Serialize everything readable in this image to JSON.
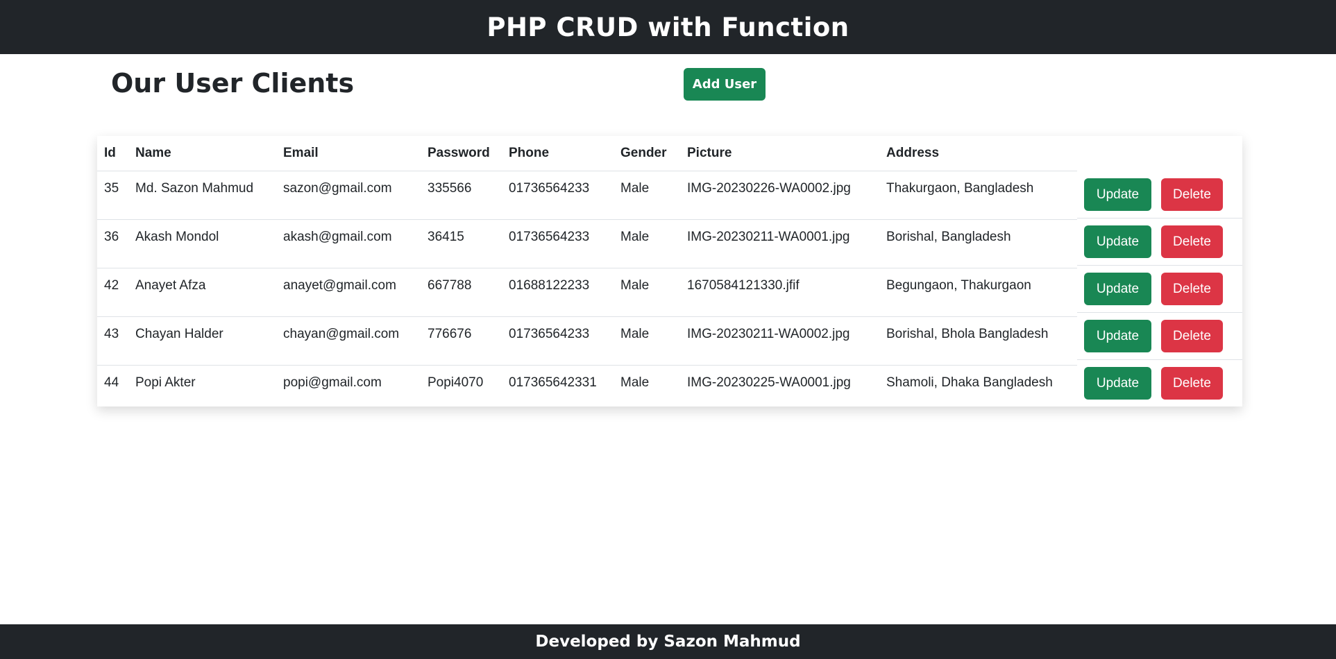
{
  "header": {
    "title": "PHP CRUD with Function"
  },
  "main": {
    "heading": "Our User Clients",
    "add_button_label": "Add User"
  },
  "table": {
    "columns": [
      "Id",
      "Name",
      "Email",
      "Password",
      "Phone",
      "Gender",
      "Picture",
      "Address"
    ],
    "rows": [
      [
        "35",
        "Md. Sazon Mahmud",
        "sazon@gmail.com",
        "335566",
        "01736564233",
        "Male",
        "IMG-20230226-WA0002.jpg",
        "Thakurgaon, Bangladesh"
      ],
      [
        "36",
        "Akash Mondol",
        "akash@gmail.com",
        "36415",
        "01736564233",
        "Male",
        "IMG-20230211-WA0001.jpg",
        "Borishal, Bangladesh"
      ],
      [
        "42",
        "Anayet Afza",
        "anayet@gmail.com",
        "667788",
        "01688122233",
        "Male",
        "1670584121330.jfif",
        "Begungaon, Thakurgaon"
      ],
      [
        "43",
        "Chayan Halder",
        "chayan@gmail.com",
        "776676",
        "01736564233",
        "Male",
        "IMG-20230211-WA0002.jpg",
        "Borishal, Bhola Bangladesh"
      ],
      [
        "44",
        "Popi Akter",
        "popi@gmail.com",
        "Popi4070",
        "017365642331",
        "Male",
        "IMG-20230225-WA0001.jpg",
        "Shamoli, Dhaka Bangladesh"
      ]
    ],
    "update_label": "Update",
    "delete_label": "Delete"
  },
  "footer": {
    "text": "Developed by Sazon Mahmud"
  },
  "colors": {
    "dark": "#212529",
    "success": "#198754",
    "danger": "#dc3545"
  }
}
